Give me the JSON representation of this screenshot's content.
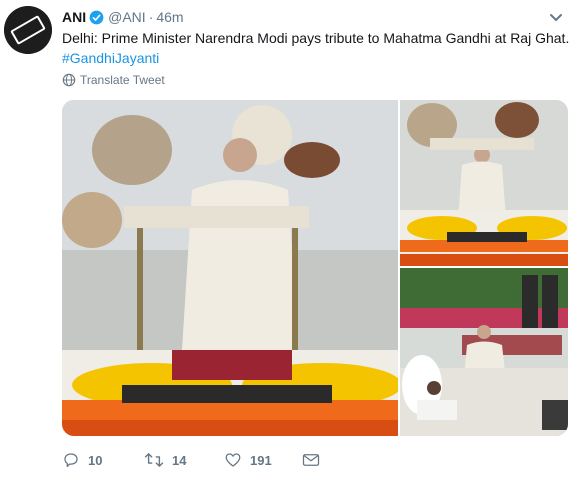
{
  "user": {
    "name": "ANI",
    "handle": "@ANI",
    "time": "46m",
    "avatar_text": "ANI"
  },
  "tweet": {
    "text": "Delhi: Prime Minister Narendra Modi pays tribute to Mahatma Gandhi at Raj Ghat.",
    "hashtag": "#GandhiJayanti"
  },
  "translate": {
    "label": "Translate Tweet"
  },
  "actions": {
    "reply_count": "10",
    "retweet_count": "14",
    "like_count": "191"
  },
  "colors": {
    "link": "#1b95e0",
    "verified": "#1da1f2",
    "muted": "#657786"
  }
}
